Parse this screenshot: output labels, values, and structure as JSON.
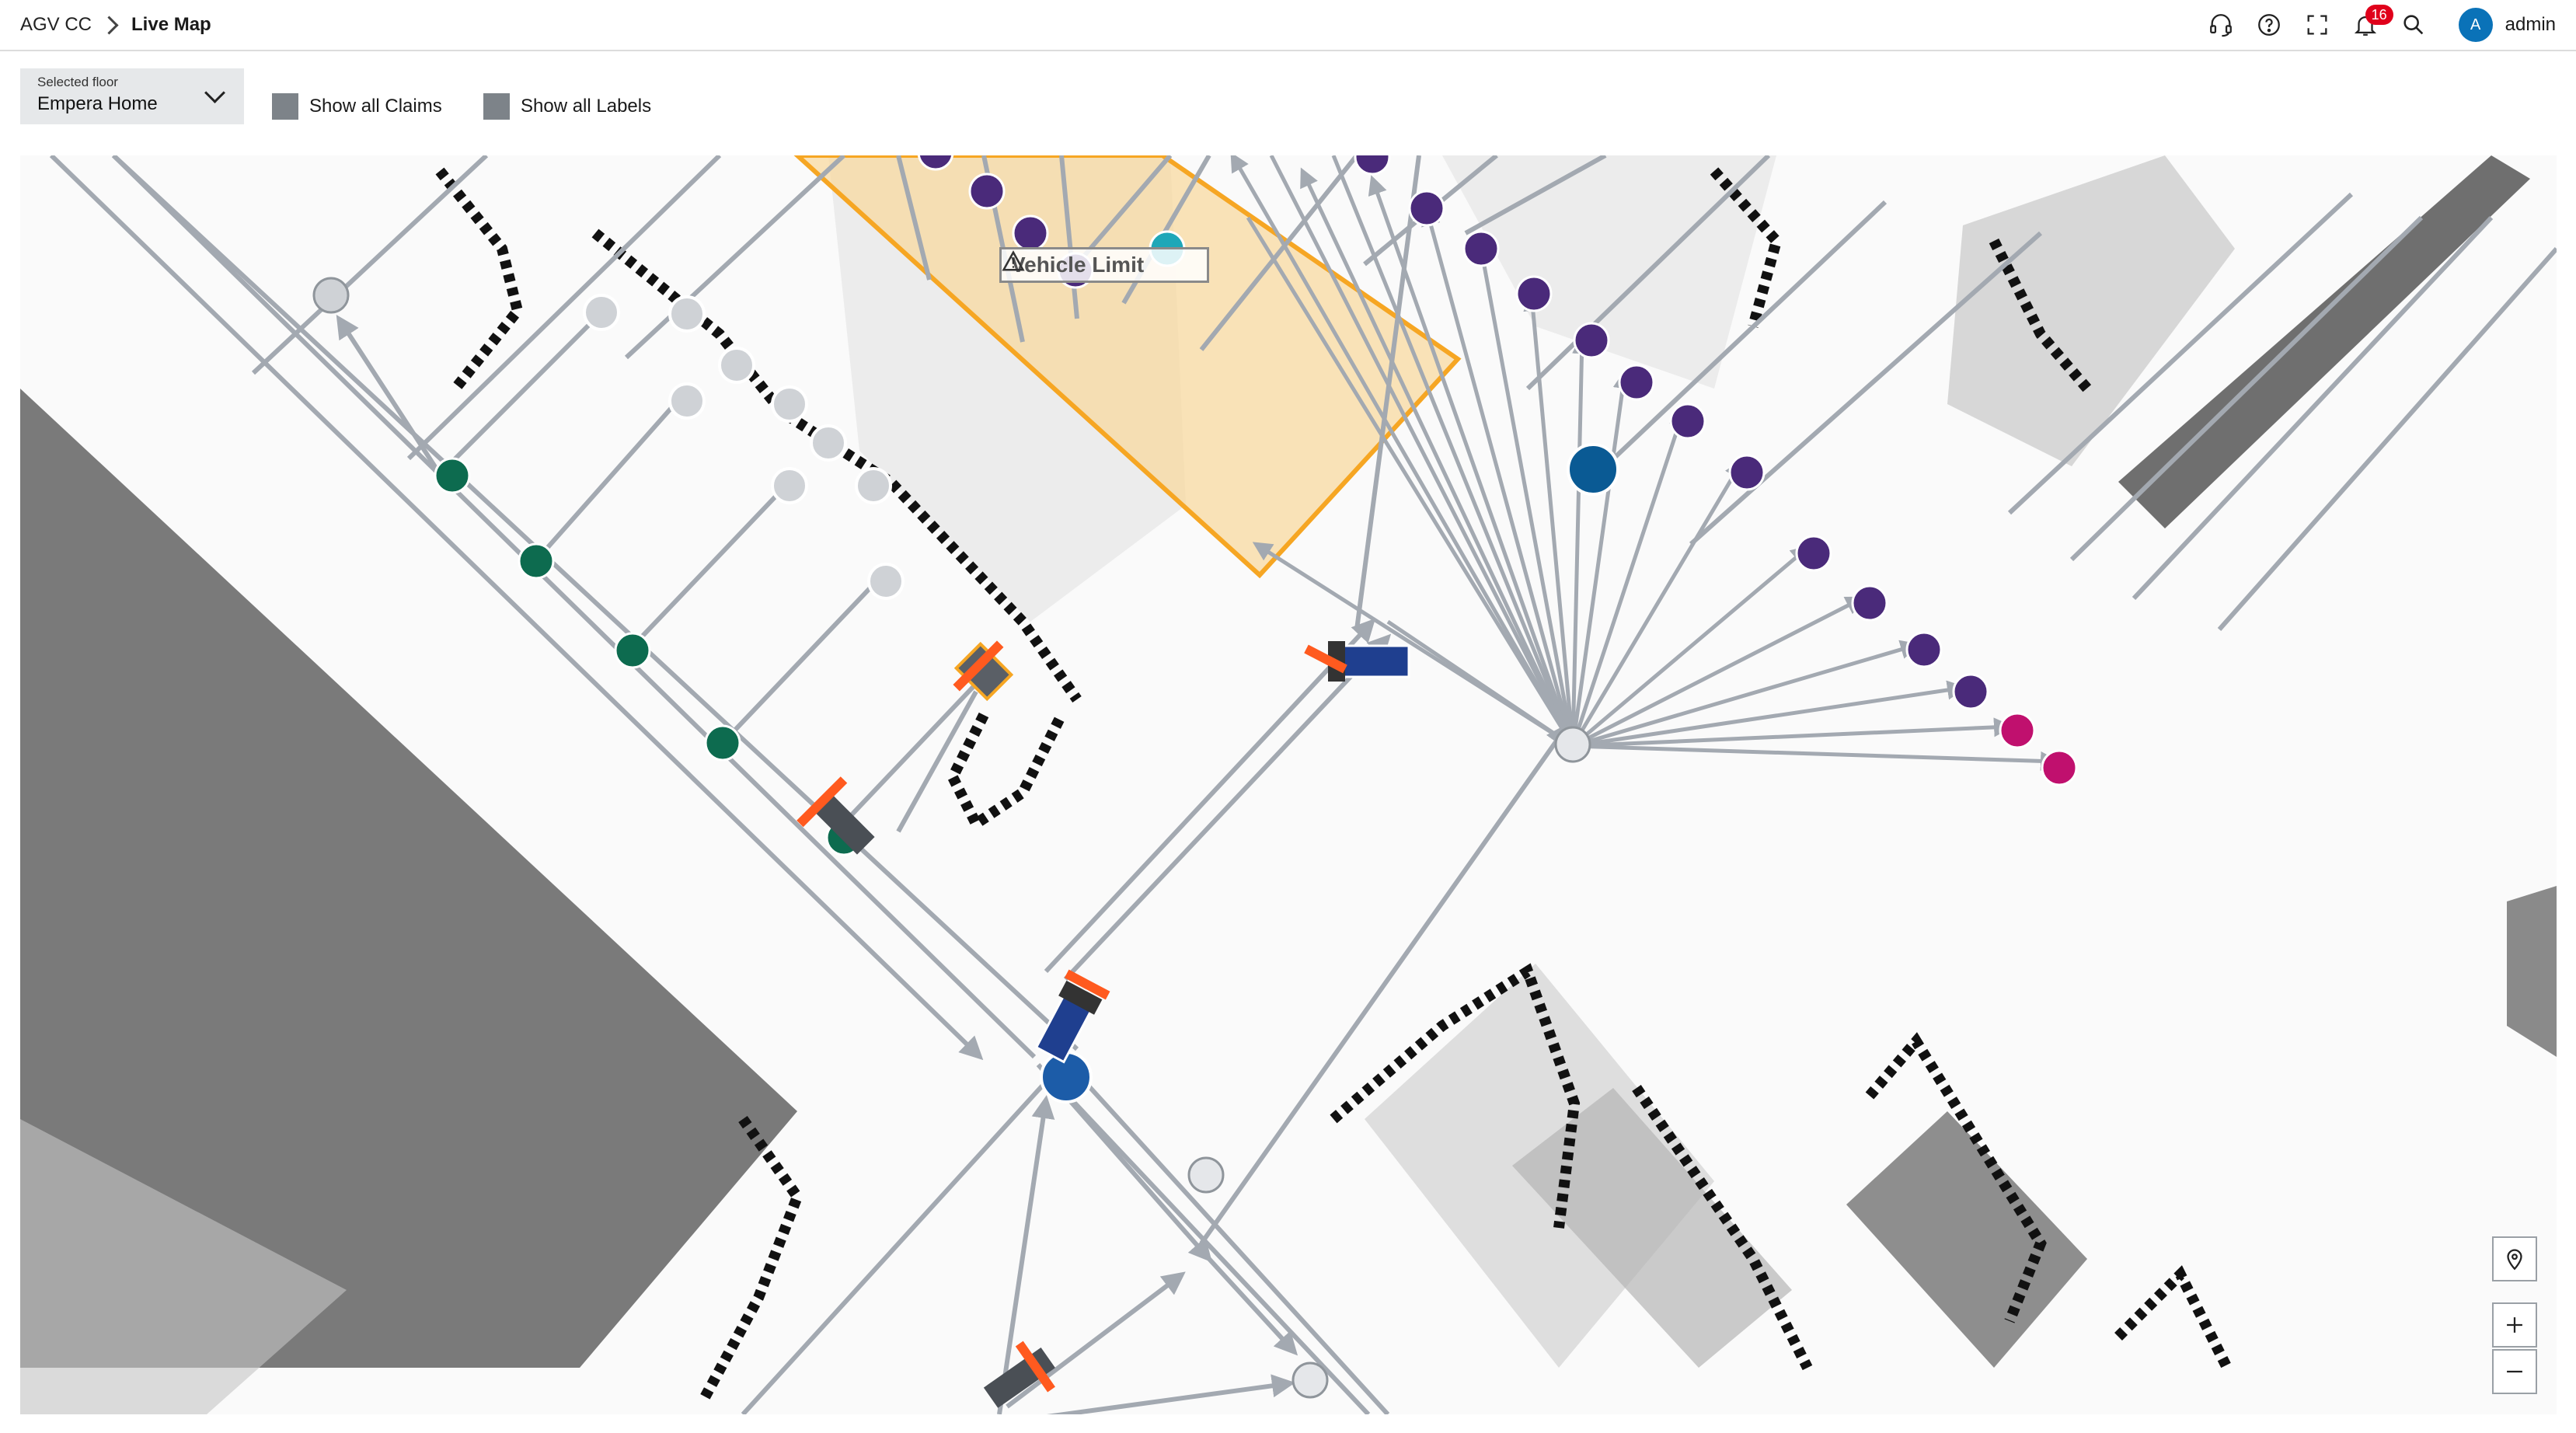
{
  "header": {
    "breadcrumb_root": "AGV CC",
    "breadcrumb_current": "Live Map",
    "notification_count": "16",
    "user_initial": "A",
    "username": "admin",
    "icons": [
      "headset-icon",
      "help-icon",
      "fullscreen-icon",
      "bell-icon",
      "search-icon"
    ]
  },
  "toolbar": {
    "floor_label": "Selected floor",
    "floor_value": "Empera Home",
    "claims_label": "Show all Claims",
    "labels_label": "Show all Labels"
  },
  "map": {
    "zone_label": "Vehicle Limit",
    "zone_color": "#f6a623",
    "route_color": "#a3a9b1",
    "pickup_station_color": "#4a2a7a",
    "drop_station_color": "#c0106e",
    "charger_station_color": "#0d6b4f",
    "vehicle_color": "#1f3f8f",
    "controls": [
      "location-icon",
      "zoom-in-icon",
      "zoom-out-icon"
    ]
  },
  "colors": {
    "accent": "#0a72b8",
    "badge": "#e0001b"
  }
}
